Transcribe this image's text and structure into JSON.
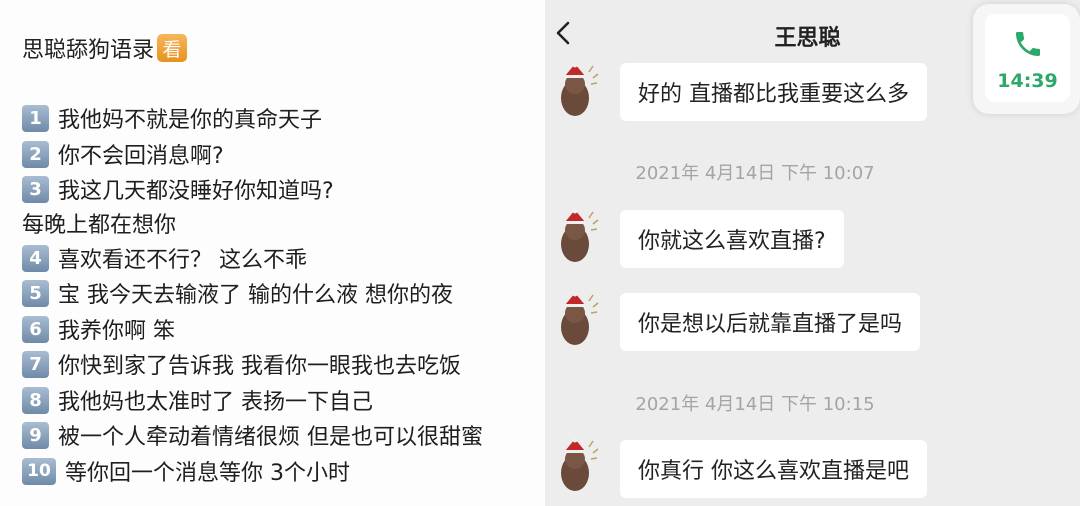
{
  "note": {
    "title": "思聪舔狗语录",
    "badge": "看",
    "lines": [
      {
        "num": "1",
        "text": "我他妈不就是你的真命天子"
      },
      {
        "num": "2",
        "text": "你不会回消息啊?"
      },
      {
        "num": "3",
        "text": "我这几天都没睡好你知道吗?"
      },
      {
        "num": "",
        "text": "每晚上都在想你"
      },
      {
        "num": "4",
        "text": "喜欢看还不行？ 这么不乖"
      },
      {
        "num": "5",
        "text": "宝 我今天去输液了 输的什么液 想你的夜"
      },
      {
        "num": "6",
        "text": "我养你啊 笨"
      },
      {
        "num": "7",
        "text": "你快到家了告诉我 我看你一眼我也去吃饭"
      },
      {
        "num": "8",
        "text": "我他妈也太准时了 表扬一下自己"
      },
      {
        "num": "9",
        "text": "被一个人牵动着情绪很烦 但是也可以很甜蜜"
      },
      {
        "num": "10",
        "text": "等你回一个消息等你 3个小时"
      }
    ]
  },
  "chat": {
    "title": "王思聪",
    "messages": [
      {
        "text": "好的 直播都比我重要这么多"
      },
      {
        "text": "你就这么喜欢直播?"
      },
      {
        "text": "你是想以后就靠直播了是吗"
      },
      {
        "text": "你真行 你这么喜欢直播是吧"
      }
    ],
    "timestamps": [
      "2021年 4月14日 下午 10:07",
      "2021年 4月14日 下午 10:15"
    ]
  },
  "call": {
    "time": "14:39",
    "icon": "phone-icon",
    "color": "#2ca86b"
  }
}
